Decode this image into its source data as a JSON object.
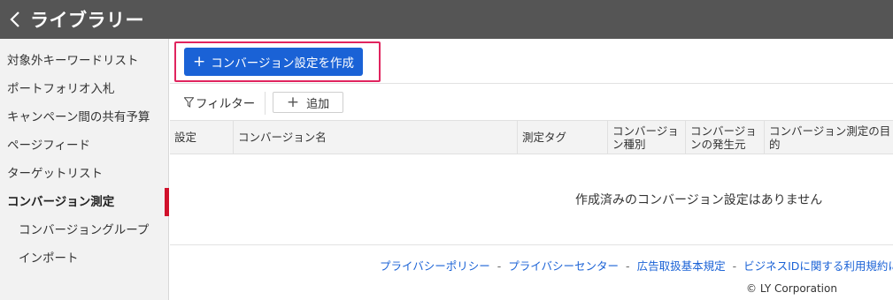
{
  "header": {
    "title": "ライブラリー"
  },
  "sidebar": {
    "items": [
      {
        "label": "対象外キーワードリスト"
      },
      {
        "label": "ポートフォリオ入札"
      },
      {
        "label": "キャンペーン間の共有予算"
      },
      {
        "label": "ページフィード"
      },
      {
        "label": "ターゲットリスト"
      },
      {
        "label": "コンバージョン測定"
      },
      {
        "label": "コンバージョングループ"
      },
      {
        "label": "インポート"
      }
    ]
  },
  "toolbar": {
    "create_label": "コンバージョン設定を作成"
  },
  "filter": {
    "filter_label": "フィルター",
    "add_label": "追加"
  },
  "table": {
    "columns": [
      "設定",
      "コンバージョン名",
      "測定タグ",
      "コンバージョン種別",
      "コンバージョンの発生元",
      "コンバージョン測定の目的"
    ],
    "empty_message": "作成済みのコンバージョン設定はありません"
  },
  "footer": {
    "links": [
      "プライバシーポリシー",
      "プライバシーセンター",
      "広告取扱基本規定",
      "ビジネスIDに関する利用規約につ"
    ],
    "separator": "-",
    "copyright": "© LY Corporation"
  },
  "colors": {
    "header_bg": "#555555",
    "primary": "#1a62d6",
    "highlight": "#e0245e",
    "active_marker": "#d0112b"
  }
}
